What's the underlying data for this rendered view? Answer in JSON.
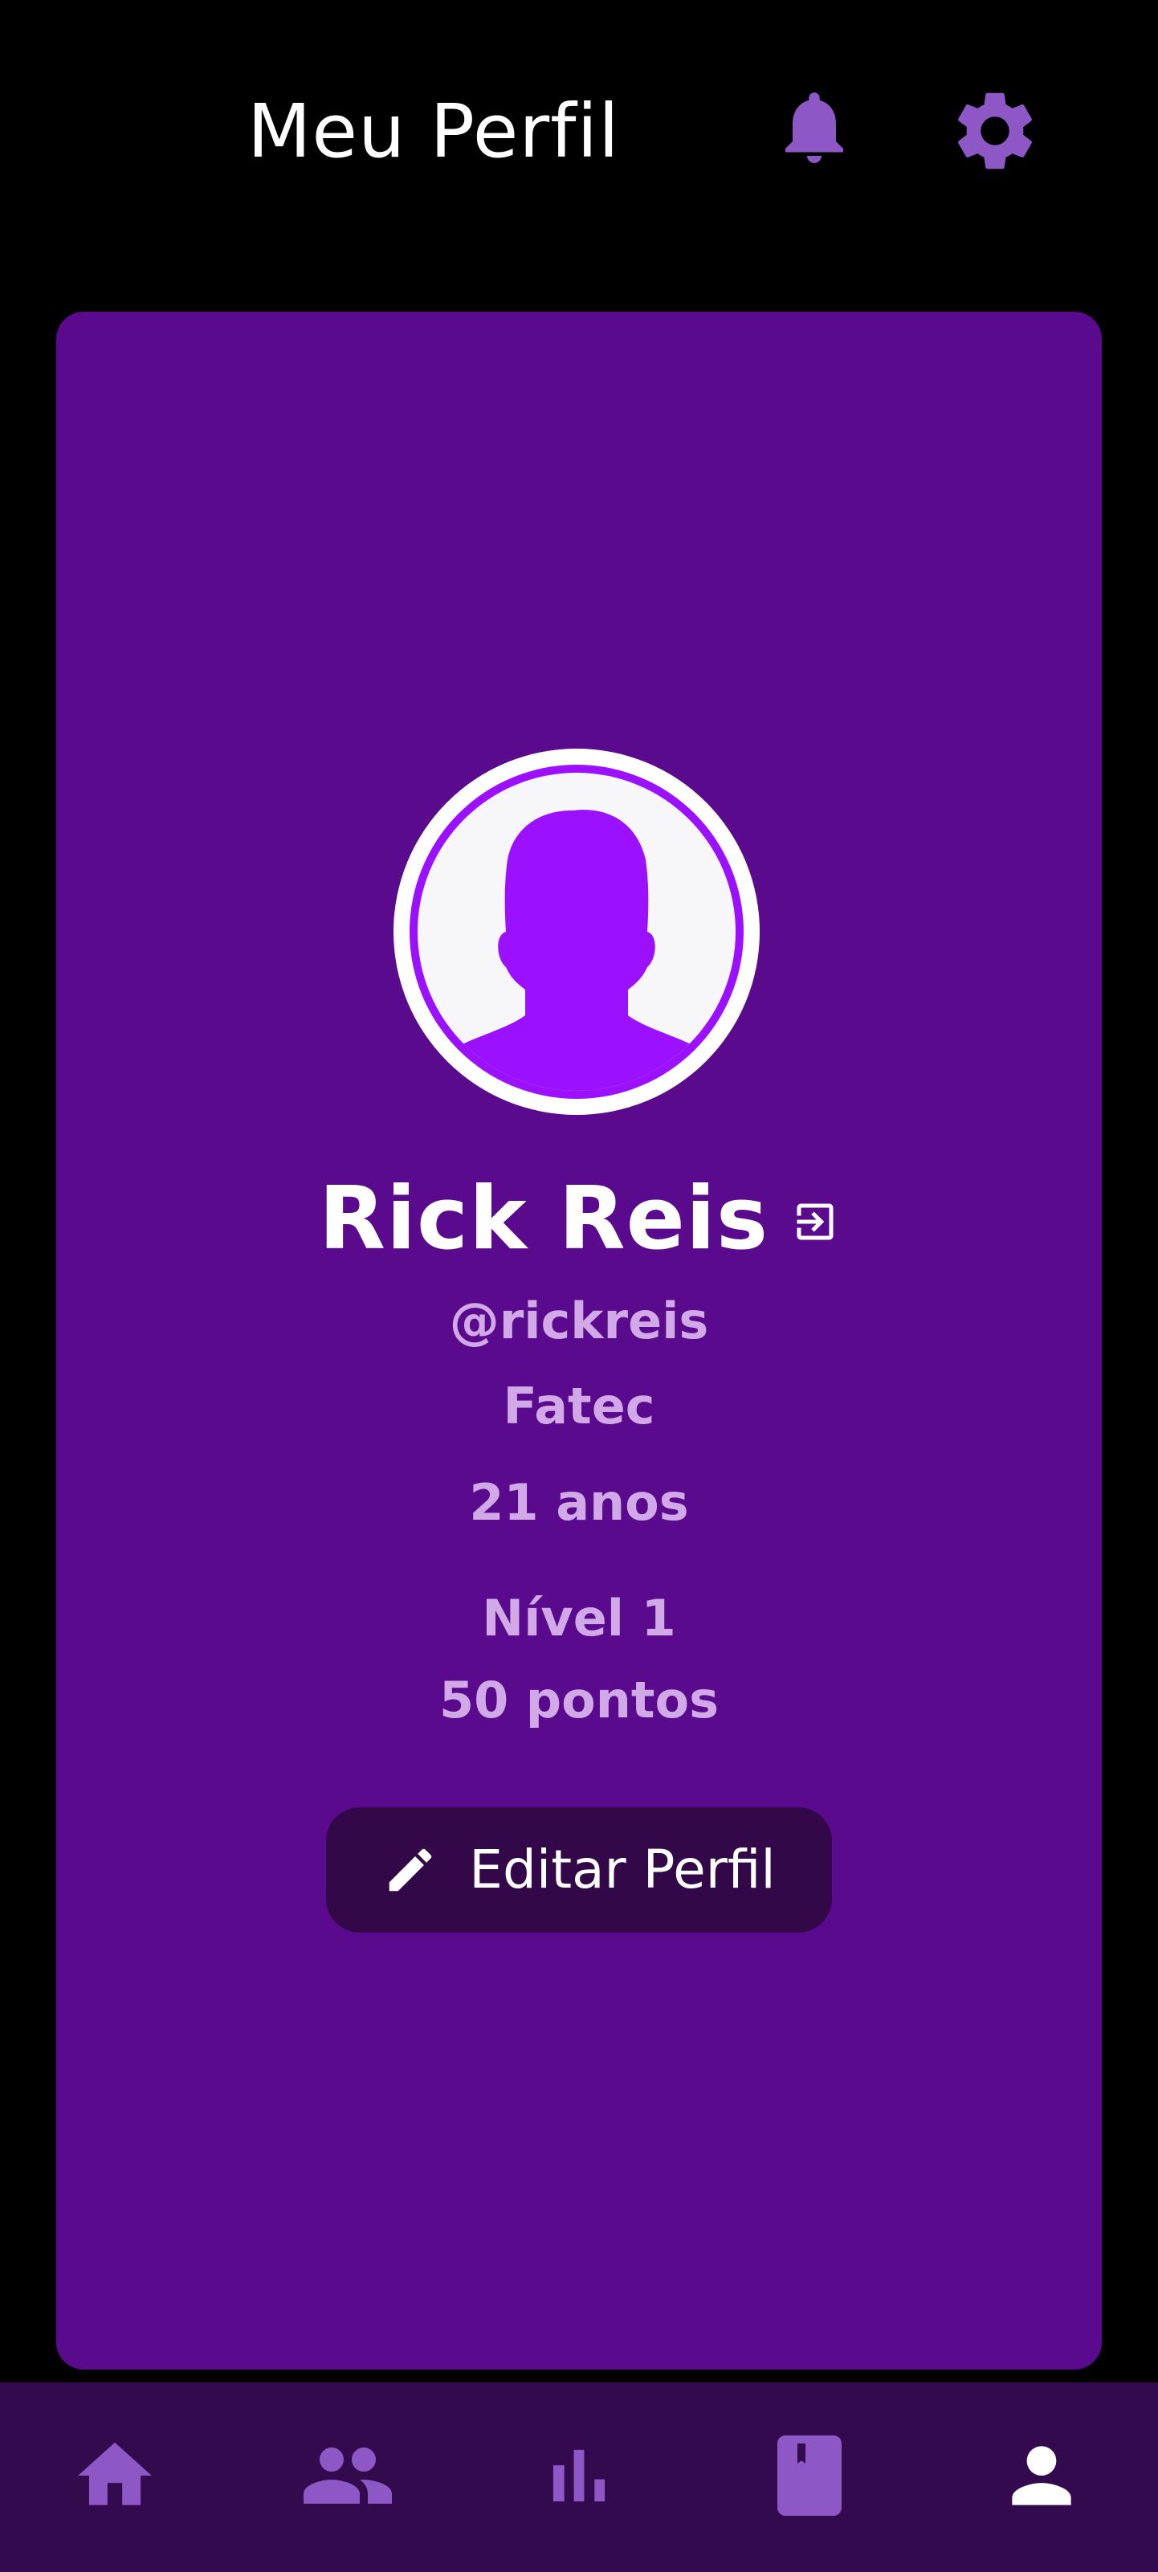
{
  "header": {
    "title": "Meu Perfil",
    "notifications_icon": "bell-icon",
    "settings_icon": "gear-icon"
  },
  "profile": {
    "name": "Rick Reis",
    "handle": "@rickreis",
    "school": "Fatec",
    "age": "21 anos",
    "level": "Nível 1",
    "points": "50 pontos",
    "avatar_icon": "person-silhouette",
    "logout_icon": "logout-icon"
  },
  "edit_button": {
    "label": "Editar Perfil",
    "icon": "pencil-icon"
  },
  "bottom_nav": {
    "items": [
      {
        "icon": "home-icon",
        "active": false
      },
      {
        "icon": "group-icon",
        "active": false
      },
      {
        "icon": "bar-chart-icon",
        "active": false
      },
      {
        "icon": "book-icon",
        "active": false
      },
      {
        "icon": "person-icon",
        "active": true
      }
    ]
  },
  "colors": {
    "background": "#000000",
    "card": "#5a0a8c",
    "accent": "#9b10ff",
    "muted_text": "#d1a9e6",
    "button": "#330848",
    "nav_bar": "#330a4e",
    "nav_icon": "#8e57c6",
    "nav_icon_active": "#ffffff"
  }
}
